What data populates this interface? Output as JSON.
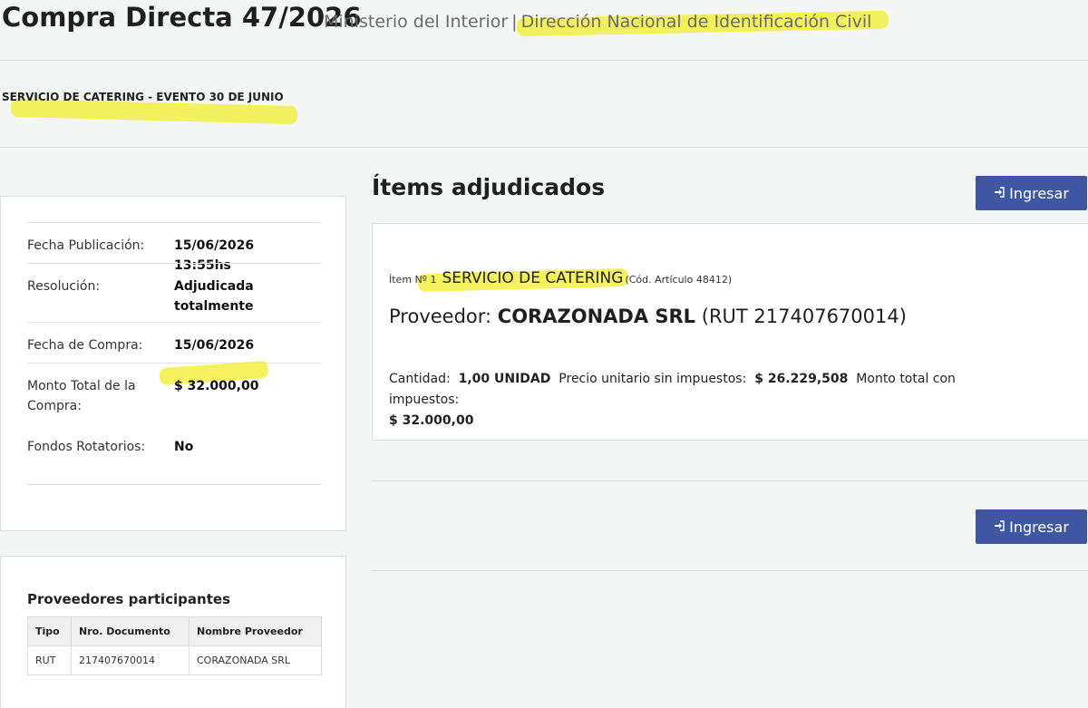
{
  "header": {
    "title": "Compra Directa 47/2026",
    "ministry": "Ministerio del Interior",
    "separator": "|",
    "office": "Dirección Nacional de Identificación Civil"
  },
  "subtitle": "SERVICIO DE CATERING - EVENTO 30 DE JUNIO",
  "info": {
    "rows": [
      {
        "label": "Fecha Publicación:",
        "value": "15/06/2026 13:55hs"
      },
      {
        "label": "Resolución:",
        "value": "Adjudicada totalmente"
      },
      {
        "label": "Fecha de Compra:",
        "value": "15/06/2026"
      },
      {
        "label": "Monto Total de la Compra:",
        "value": "$ 32.000,00"
      },
      {
        "label": "Fondos Rotatorios:",
        "value": "No"
      }
    ]
  },
  "providers": {
    "title": "Proveedores participantes",
    "columns": [
      "Tipo",
      "Nro. Documento",
      "Nombre Proveedor"
    ],
    "rows": [
      [
        "RUT",
        "217407670014",
        "CORAZONADA SRL"
      ]
    ]
  },
  "items": {
    "heading": "Ítems adjudicados",
    "button_label": "Ingresar",
    "item": {
      "prefix": "Ítem Nº 1",
      "name": "SERVICIO DE CATERING",
      "code": "(Cód. Artículo 48412)",
      "provider_label": "Proveedor:",
      "provider_name": "CORAZONADA SRL",
      "provider_rut": "(RUT 217407670014)",
      "qty_label": "Cantidad:",
      "qty_value": "1,00 UNIDAD",
      "unit_price_label": "Precio unitario sin impuestos:",
      "unit_price_value": "$ 26.229,508",
      "total_label": "Monto total con impuestos:",
      "total_value": "$ 32.000,00"
    }
  },
  "colors": {
    "button": "#3f57a2",
    "highlight": "#f3ee2a"
  },
  "icons": {
    "login": "sign-in-icon"
  }
}
